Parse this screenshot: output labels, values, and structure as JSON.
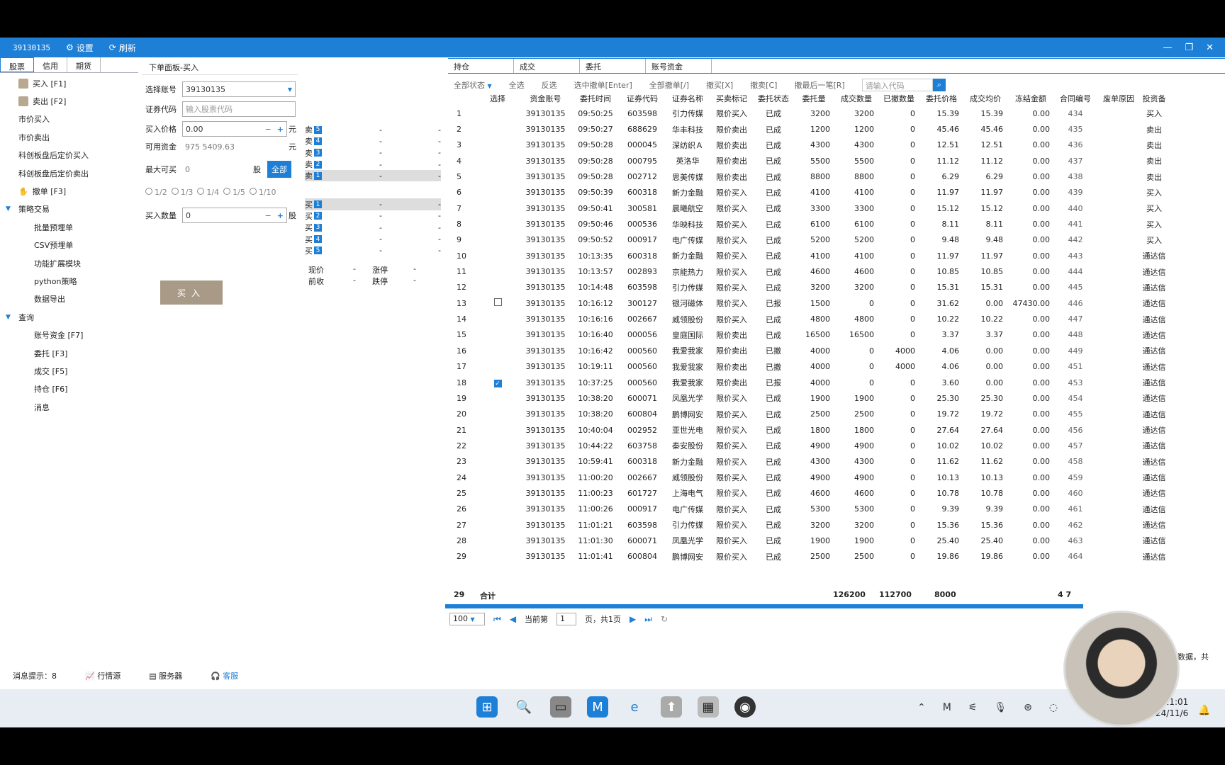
{
  "titlebar": {
    "account": "39130135",
    "settings_label": "设置",
    "refresh_label": "刷新"
  },
  "left_tabs": [
    "股票",
    "信用",
    "期货"
  ],
  "sidebar": {
    "items": [
      {
        "label": "买入 [F1]",
        "icon": "buy-icon"
      },
      {
        "label": "卖出 [F2]",
        "icon": "sell-icon"
      },
      {
        "label": "市价买入"
      },
      {
        "label": "市价卖出"
      },
      {
        "label": "科创板盘后定价买入"
      },
      {
        "label": "科创板盘后定价卖出"
      },
      {
        "label": "撤单 [F3]",
        "icon": "cancel-icon"
      }
    ],
    "strategy_group": "策略交易",
    "strategy_items": [
      "批量预埋单",
      "CSV预埋单",
      "功能扩展模块",
      "python策略",
      "数据导出"
    ],
    "query_group": "查询",
    "query_items": [
      "账号资金 [F7]",
      "委托 [F3]",
      "成交 [F5]",
      "持仓 [F6]",
      "消息"
    ]
  },
  "order_panel": {
    "title": "下单面板-买入",
    "account_label": "选择账号",
    "account_value": "39130135",
    "code_label": "证券代码",
    "code_placeholder": "输入股票代码",
    "price_label": "买入价格",
    "price_value": "0.00",
    "price_unit": "元",
    "funds_label": "可用资金",
    "funds_value": "975 5409.63",
    "funds_unit": "元",
    "max_label": "最大可买",
    "max_value": "0",
    "max_unit": "股",
    "all_button": "全部",
    "fractions": [
      "1/2",
      "1/3",
      "1/4",
      "1/5",
      "1/10"
    ],
    "qty_label": "买入数量",
    "qty_value": "0",
    "qty_unit": "股",
    "buy_button": "买入"
  },
  "book": {
    "sell": [
      {
        "label": "卖",
        "n": "5"
      },
      {
        "label": "卖",
        "n": "4"
      },
      {
        "label": "卖",
        "n": "3"
      },
      {
        "label": "卖",
        "n": "2"
      },
      {
        "label": "卖",
        "n": "1"
      }
    ],
    "buy": [
      {
        "label": "买",
        "n": "1"
      },
      {
        "label": "买",
        "n": "2"
      },
      {
        "label": "买",
        "n": "3"
      },
      {
        "label": "买",
        "n": "4"
      },
      {
        "label": "买",
        "n": "5"
      }
    ],
    "dash": "-",
    "quote": [
      {
        "a": "现价",
        "b": "-",
        "c": "涨停",
        "d": "-"
      },
      {
        "a": "前收",
        "b": "-",
        "c": "跌停",
        "d": "-"
      }
    ]
  },
  "right_tabs": [
    "持仓",
    "成交",
    "委托",
    "账号资金"
  ],
  "filter_bar": {
    "status": "全部状态",
    "select_all": "全选",
    "invert": "反选",
    "cancel_selected": "选中撤单[Enter]",
    "cancel_all": "全部撤单[/]",
    "cancel_buy": "撤买[X]",
    "cancel_sell": "撤卖[C]",
    "cancel_all_key": "撤最后一笔[R]",
    "search_placeholder": "请输入代码"
  },
  "table": {
    "headers": [
      "",
      "选择",
      "资金账号",
      "委托时间",
      "证券代码",
      "证券名称",
      "买卖标记",
      "委托状态",
      "委托量",
      "成交数量",
      "已撤数量",
      "委托价格",
      "成交均价",
      "冻结金额",
      "合同编号",
      "废单原因",
      "投资备"
    ],
    "rows": [
      [
        "1",
        "",
        "39130135",
        "09:50:25",
        "603598",
        "引力传媒",
        "限价买入",
        "已成",
        "3200",
        "3200",
        "0",
        "15.39",
        "15.39",
        "0.00",
        "434",
        "",
        "买入"
      ],
      [
        "2",
        "",
        "39130135",
        "09:50:27",
        "688629",
        "华丰科技",
        "限价卖出",
        "已成",
        "1200",
        "1200",
        "0",
        "45.46",
        "45.46",
        "0.00",
        "435",
        "",
        "卖出"
      ],
      [
        "3",
        "",
        "39130135",
        "09:50:28",
        "000045",
        "深纺织Ａ",
        "限价卖出",
        "已成",
        "4300",
        "4300",
        "0",
        "12.51",
        "12.51",
        "0.00",
        "436",
        "",
        "卖出"
      ],
      [
        "4",
        "",
        "39130135",
        "09:50:28",
        "000795",
        "英洛华",
        "限价卖出",
        "已成",
        "5500",
        "5500",
        "0",
        "11.12",
        "11.12",
        "0.00",
        "437",
        "",
        "卖出"
      ],
      [
        "5",
        "",
        "39130135",
        "09:50:28",
        "002712",
        "思美传媒",
        "限价卖出",
        "已成",
        "8800",
        "8800",
        "0",
        "6.29",
        "6.29",
        "0.00",
        "438",
        "",
        "卖出"
      ],
      [
        "6",
        "",
        "39130135",
        "09:50:39",
        "600318",
        "新力金融",
        "限价买入",
        "已成",
        "4100",
        "4100",
        "0",
        "11.97",
        "11.97",
        "0.00",
        "439",
        "",
        "买入"
      ],
      [
        "7",
        "",
        "39130135",
        "09:50:41",
        "300581",
        "晨曦航空",
        "限价买入",
        "已成",
        "3300",
        "3300",
        "0",
        "15.12",
        "15.12",
        "0.00",
        "440",
        "",
        "买入"
      ],
      [
        "8",
        "",
        "39130135",
        "09:50:46",
        "000536",
        "华映科技",
        "限价买入",
        "已成",
        "6100",
        "6100",
        "0",
        "8.11",
        "8.11",
        "0.00",
        "441",
        "",
        "买入"
      ],
      [
        "9",
        "",
        "39130135",
        "09:50:52",
        "000917",
        "电广传媒",
        "限价买入",
        "已成",
        "5200",
        "5200",
        "0",
        "9.48",
        "9.48",
        "0.00",
        "442",
        "",
        "买入"
      ],
      [
        "10",
        "",
        "39130135",
        "10:13:35",
        "600318",
        "新力金融",
        "限价买入",
        "已成",
        "4100",
        "4100",
        "0",
        "11.97",
        "11.97",
        "0.00",
        "443",
        "",
        "通达信"
      ],
      [
        "11",
        "",
        "39130135",
        "10:13:57",
        "002893",
        "京能热力",
        "限价买入",
        "已成",
        "4600",
        "4600",
        "0",
        "10.85",
        "10.85",
        "0.00",
        "444",
        "",
        "通达信"
      ],
      [
        "12",
        "",
        "39130135",
        "10:14:48",
        "603598",
        "引力传媒",
        "限价买入",
        "已成",
        "3200",
        "3200",
        "0",
        "15.31",
        "15.31",
        "0.00",
        "445",
        "",
        "通达信"
      ],
      [
        "13",
        "box",
        "39130135",
        "10:16:12",
        "300127",
        "银河磁体",
        "限价买入",
        "已报",
        "1500",
        "0",
        "0",
        "31.62",
        "0.00",
        "47430.00",
        "446",
        "",
        "通达信"
      ],
      [
        "14",
        "",
        "39130135",
        "10:16:16",
        "002667",
        "威领股份",
        "限价买入",
        "已成",
        "4800",
        "4800",
        "0",
        "10.22",
        "10.22",
        "0.00",
        "447",
        "",
        "通达信"
      ],
      [
        "15",
        "",
        "39130135",
        "10:16:40",
        "000056",
        "皇庭国际",
        "限价卖出",
        "已成",
        "16500",
        "16500",
        "0",
        "3.37",
        "3.37",
        "0.00",
        "448",
        "",
        "通达信"
      ],
      [
        "16",
        "",
        "39130135",
        "10:16:42",
        "000560",
        "我爱我家",
        "限价卖出",
        "已撤",
        "4000",
        "0",
        "4000",
        "4.06",
        "0.00",
        "0.00",
        "449",
        "",
        "通达信"
      ],
      [
        "17",
        "",
        "39130135",
        "10:19:11",
        "000560",
        "我爱我家",
        "限价卖出",
        "已撤",
        "4000",
        "0",
        "4000",
        "4.06",
        "0.00",
        "0.00",
        "451",
        "",
        "通达信"
      ],
      [
        "18",
        "checked",
        "39130135",
        "10:37:25",
        "000560",
        "我爱我家",
        "限价卖出",
        "已报",
        "4000",
        "0",
        "0",
        "3.60",
        "0.00",
        "0.00",
        "453",
        "",
        "通达信"
      ],
      [
        "19",
        "",
        "39130135",
        "10:38:20",
        "600071",
        "凤凰光学",
        "限价买入",
        "已成",
        "1900",
        "1900",
        "0",
        "25.30",
        "25.30",
        "0.00",
        "454",
        "",
        "通达信"
      ],
      [
        "20",
        "",
        "39130135",
        "10:38:20",
        "600804",
        "鹏博网安",
        "限价买入",
        "已成",
        "2500",
        "2500",
        "0",
        "19.72",
        "19.72",
        "0.00",
        "455",
        "",
        "通达信"
      ],
      [
        "21",
        "",
        "39130135",
        "10:40:04",
        "002952",
        "亚世光电",
        "限价买入",
        "已成",
        "1800",
        "1800",
        "0",
        "27.64",
        "27.64",
        "0.00",
        "456",
        "",
        "通达信"
      ],
      [
        "22",
        "",
        "39130135",
        "10:44:22",
        "603758",
        "秦安股份",
        "限价买入",
        "已成",
        "4900",
        "4900",
        "0",
        "10.02",
        "10.02",
        "0.00",
        "457",
        "",
        "通达信"
      ],
      [
        "23",
        "",
        "39130135",
        "10:59:41",
        "600318",
        "新力金融",
        "限价买入",
        "已成",
        "4300",
        "4300",
        "0",
        "11.62",
        "11.62",
        "0.00",
        "458",
        "",
        "通达信"
      ],
      [
        "24",
        "",
        "39130135",
        "11:00:20",
        "002667",
        "威领股份",
        "限价买入",
        "已成",
        "4900",
        "4900",
        "0",
        "10.13",
        "10.13",
        "0.00",
        "459",
        "",
        "通达信"
      ],
      [
        "25",
        "",
        "39130135",
        "11:00:23",
        "601727",
        "上海电气",
        "限价买入",
        "已成",
        "4600",
        "4600",
        "0",
        "10.78",
        "10.78",
        "0.00",
        "460",
        "",
        "通达信"
      ],
      [
        "26",
        "",
        "39130135",
        "11:00:26",
        "000917",
        "电广传媒",
        "限价买入",
        "已成",
        "5300",
        "5300",
        "0",
        "9.39",
        "9.39",
        "0.00",
        "461",
        "",
        "通达信"
      ],
      [
        "27",
        "",
        "39130135",
        "11:01:21",
        "603598",
        "引力传媒",
        "限价买入",
        "已成",
        "3200",
        "3200",
        "0",
        "15.36",
        "15.36",
        "0.00",
        "462",
        "",
        "通达信"
      ],
      [
        "28",
        "",
        "39130135",
        "11:01:30",
        "600071",
        "凤凰光学",
        "限价买入",
        "已成",
        "1900",
        "1900",
        "0",
        "25.40",
        "25.40",
        "0.00",
        "463",
        "",
        "通达信"
      ],
      [
        "29",
        "",
        "39130135",
        "11:01:41",
        "600804",
        "鹏博网安",
        "限价买入",
        "已成",
        "2500",
        "2500",
        "0",
        "19.86",
        "19.86",
        "0.00",
        "464",
        "",
        "通达信"
      ]
    ]
  },
  "totals": {
    "count": "29",
    "label": "合计",
    "qty": "126200",
    "filled": "112700",
    "cancelled": "8000",
    "frozen": "4 7"
  },
  "pager": {
    "page_size": "100",
    "current_label": "当前第",
    "current_page": "1",
    "total_label": "页，共1页",
    "trailing": "条数据，共"
  },
  "status_bar": {
    "message_label": "消息提示：",
    "message_count": "8",
    "market_label": "行情源",
    "server_label": "服务器",
    "service_label": "客服"
  },
  "clock": {
    "time": "11:01",
    "date": "24/11/6"
  }
}
